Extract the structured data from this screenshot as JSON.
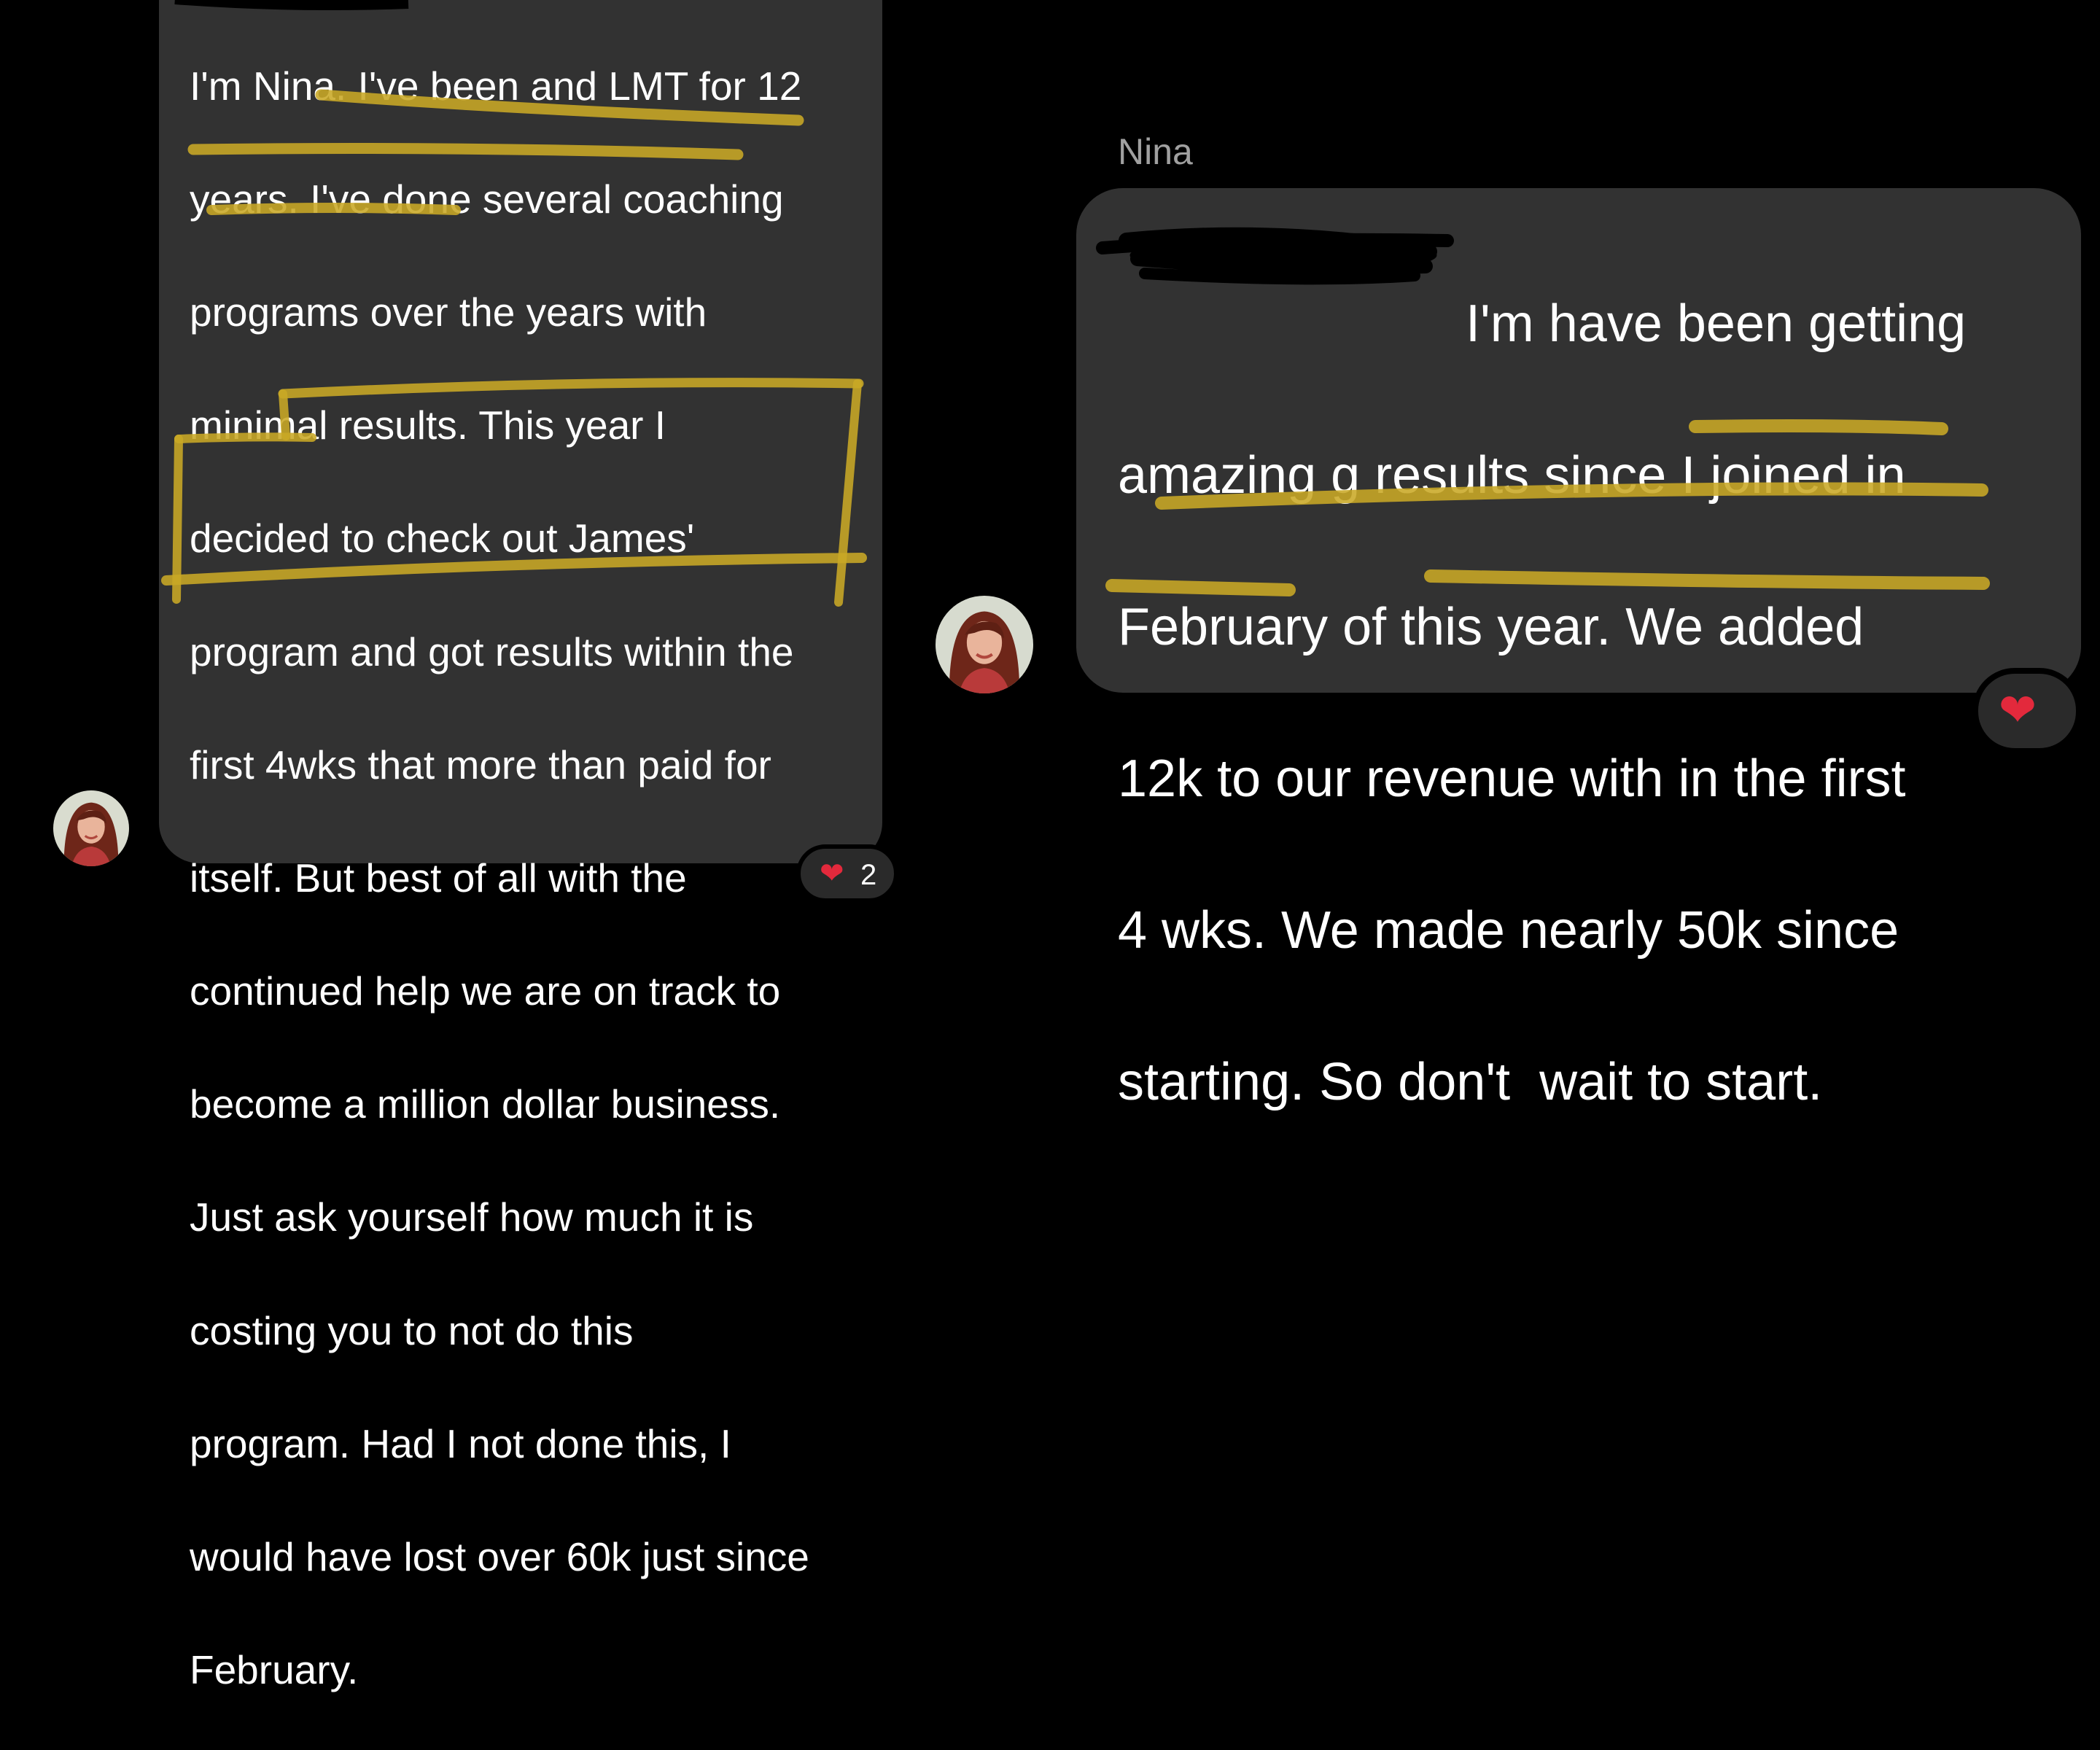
{
  "left_message": {
    "lines": [
      "I'm Nina. I've been and LMT for 12",
      "years. I've done several coaching",
      "programs over the years with",
      "minimal results. This year I",
      "decided to check out James'",
      "program and got results within the",
      "first 4wks that more than paid for",
      "itself. But best of all with the",
      "continued help we are on track to",
      "become a million dollar business.",
      "Just ask yourself how much it is",
      "costing you to not do this",
      "program. Had I not done this, I",
      "would have lost over 60k just since",
      "February."
    ],
    "reaction": {
      "icon": "heart-icon",
      "emoji": "❤",
      "count": "2"
    }
  },
  "right_message": {
    "sender": "Nina",
    "lines": [
      "I'm have been getting",
      "amazing g results since I joined in",
      "February of this year. We added",
      "12k to our revenue with in the first",
      "4 wks. We made nearly 50k since",
      "starting. So don't  wait to start."
    ],
    "reaction": {
      "icon": "heart-icon",
      "emoji": "❤"
    }
  },
  "colors": {
    "background": "#000000",
    "bubble": "#323232",
    "text": "#ffffff",
    "sender_name": "#a0a0a0",
    "highlighter": "#c9a825",
    "heart": "#e3293c",
    "redaction": "#000000"
  }
}
